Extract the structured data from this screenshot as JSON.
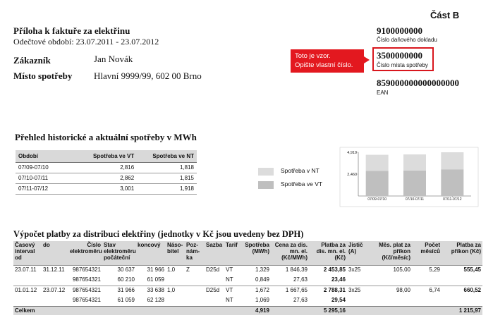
{
  "header": {
    "part": "Část B",
    "title": "Příloha k faktuře za elektřinu",
    "period": "Odečtové období: 23.07.2011 - 23.07.2012",
    "customer_label": "Zákazník",
    "customer_value": "Jan Novák",
    "place_label": "Místo spotřeby",
    "place_value": "Hlavní 9999/99,   602 00 Brno"
  },
  "info": {
    "tax_doc_number": "9100000000",
    "tax_doc_caption": "Číslo daňového dokladu",
    "place_number": "3500000000",
    "place_caption": "Číslo místa spotřeby",
    "ean_number": "859000000000000000",
    "ean_caption": "EAN",
    "callout_line1": "Toto je vzor.",
    "callout_line2": "Opište vlastní číslo.",
    "callout_color": "#e3181f"
  },
  "history": {
    "title": "Přehled historické a aktuální spotřeby v MWh",
    "headers": [
      "Období",
      "Spotřeba ve VT",
      "Spotřeba ve NT"
    ],
    "rows": [
      [
        "07/09-07/10",
        "2,816",
        "1,818"
      ],
      [
        "07/10-07/11",
        "2,862",
        "1,815"
      ],
      [
        "07/11-07/12",
        "3,001",
        "1,918"
      ]
    ]
  },
  "legend": {
    "nt_label": "Spotřeba v NT",
    "vt_label": "Spotřeba ve VT",
    "nt_color": "#dcdcdc",
    "vt_color": "#bfbfbf"
  },
  "chart_data": {
    "type": "bar",
    "stacked": true,
    "categories": [
      "07/09-07/10",
      "07/10-07/11",
      "07/11-07/12"
    ],
    "series": [
      {
        "name": "Spotřeba ve VT",
        "values": [
          2.816,
          2.862,
          3.001
        ],
        "color": "#bfbfbf"
      },
      {
        "name": "Spotřeba v NT",
        "values": [
          1.818,
          1.815,
          1.918
        ],
        "color": "#dcdcdc"
      }
    ],
    "yticks": [
      "2,460",
      "4,919"
    ],
    "ylim": [
      0,
      4.919
    ],
    "grid": false
  },
  "calc": {
    "title": "Výpočet platby za distribuci elektřiny (jednotky v Kč jsou uvedeny bez DPH)",
    "headers": [
      "Časový interval od",
      "do",
      "Číslo elektroměru",
      "Stav elektroměru počáteční",
      "koncový",
      "Náso-bitel",
      "Poz-nám-ka",
      "Sazba",
      "Tarif",
      "Spotřeba (MWh)",
      "Cena za dis. mn. el. (Kč/MWh)",
      "Platba za dis. mn. el. (Kč)",
      "Jistič (A)",
      "Měs. plat za příkon (Kč/měsíc)",
      "Počet měsíců",
      "Platba za příkon (Kč)"
    ],
    "rows": [
      [
        "23.07.11",
        "31.12.11",
        "987654321",
        "30 637",
        "31 966",
        "1,0",
        "Z",
        "D25d",
        "VT",
        "1,329",
        "1 846,39",
        "2 453,85",
        "3x25",
        "105,00",
        "5,29",
        "555,45"
      ],
      [
        "",
        "",
        "987654321",
        "60 210",
        "61 059",
        "",
        "",
        "",
        "NT",
        "0,849",
        "27,63",
        "23,46",
        "",
        "",
        "",
        ""
      ],
      [
        "01.01.12",
        "23.07.12",
        "987654321",
        "31 966",
        "33 638",
        "1,0",
        "",
        "D25d",
        "VT",
        "1,672",
        "1 667,65",
        "2 788,31",
        "3x25",
        "98,00",
        "6,74",
        "660,52"
      ],
      [
        "",
        "",
        "987654321",
        "61 059",
        "62 128",
        "",
        "",
        "",
        "NT",
        "1,069",
        "27,63",
        "29,54",
        "",
        "",
        "",
        ""
      ]
    ],
    "total": {
      "label": "Celkem",
      "consumption": "4,919",
      "distribution_payment": "5 295,16",
      "input_payment": "1 215,97"
    }
  }
}
